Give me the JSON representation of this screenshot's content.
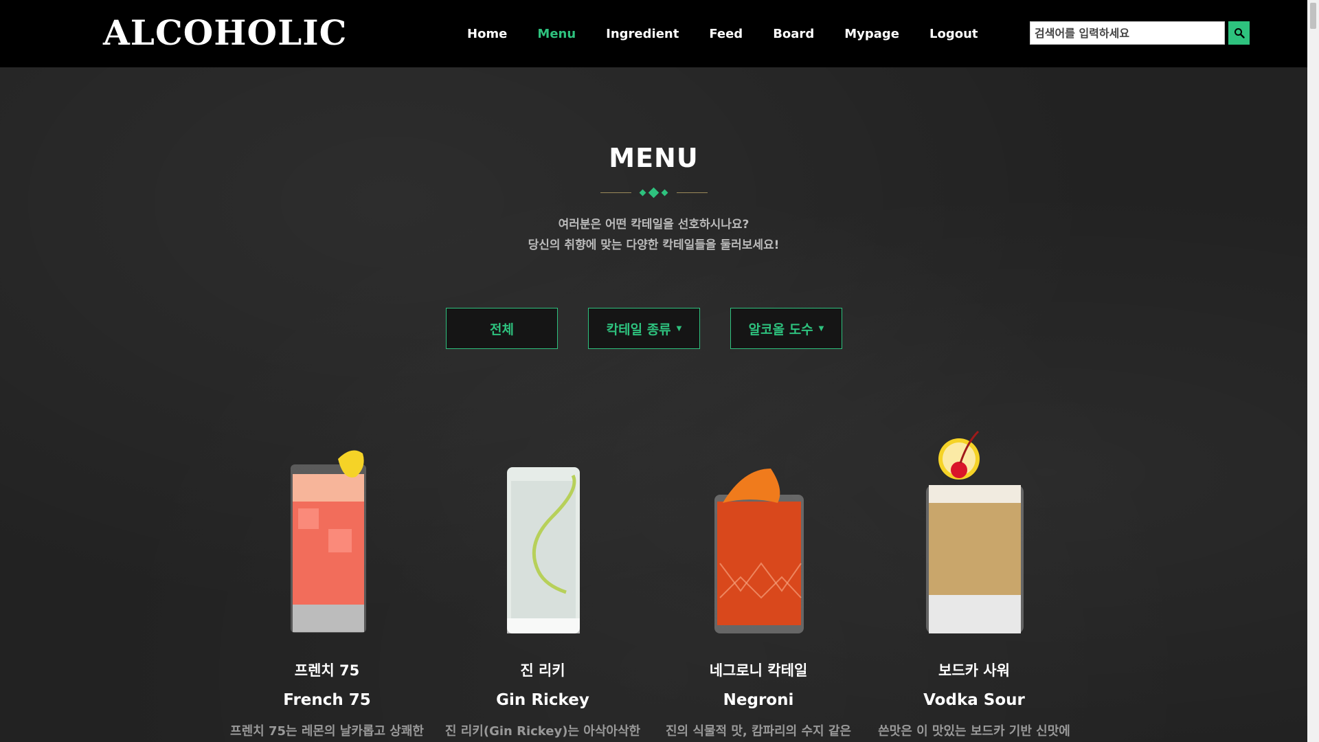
{
  "header": {
    "logo": "ALCOHOLIC",
    "nav": [
      {
        "label": "Home",
        "active": false
      },
      {
        "label": "Menu",
        "active": true
      },
      {
        "label": "Ingredient",
        "active": false
      },
      {
        "label": "Feed",
        "active": false
      },
      {
        "label": "Board",
        "active": false
      },
      {
        "label": "Mypage",
        "active": false
      },
      {
        "label": "Logout",
        "active": false
      }
    ],
    "search_placeholder": "검색어를 입력하세요"
  },
  "main": {
    "title": "MENU",
    "subtitle_line1": "여러분은 어떤 칵테일을 선호하시나요?",
    "subtitle_line2": "당신의 취향에 맞는 다양한 칵테일들을 둘러보세요!",
    "filters": [
      {
        "label": "전체",
        "dropdown": false
      },
      {
        "label": "칵테일 종류",
        "dropdown": true
      },
      {
        "label": "알코올 도수",
        "dropdown": true
      }
    ],
    "cocktails": [
      {
        "name_ko": "프렌치 75",
        "name_en": "French 75",
        "desc": "프렌치 75는 레몬의 날카롭고 상쾌한",
        "liquid": "#f26d5b",
        "garnish": "lemon-peel"
      },
      {
        "name_ko": "진 리키",
        "name_en": "Gin Rickey",
        "desc": "진 리키(Gin Rickey)는 아삭아삭한",
        "liquid": "#e6ece8",
        "garnish": "lime-spiral"
      },
      {
        "name_ko": "네그로니 칵테일",
        "name_en": "Negroni",
        "desc": "진의 식물적 맛, 캄파리의 수지 같은",
        "liquid": "#d9481c",
        "garnish": "orange-peel"
      },
      {
        "name_ko": "보드카 사워",
        "name_en": "Vodka Sour",
        "desc": "쓴맛은 이 맛있는 보드카 기반 신맛에",
        "liquid": "#c9a66b",
        "garnish": "cherry-lemon"
      }
    ]
  },
  "colors": {
    "accent": "#2ec27e",
    "header_bg": "#000000",
    "page_bg": "#222222"
  }
}
